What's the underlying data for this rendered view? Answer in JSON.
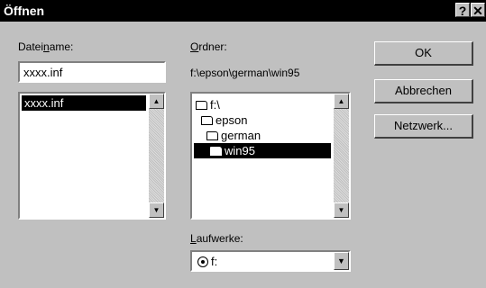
{
  "window": {
    "title": "Öffnen",
    "help_label": "?",
    "close_label": "✕"
  },
  "file": {
    "label_pre": "Datei",
    "label_key": "n",
    "label_post": "ame:",
    "value": "xxxx.inf",
    "list": [
      "xxxx.inf"
    ]
  },
  "folder": {
    "label_key": "O",
    "label_post": "rdner:",
    "path": "f:\\epson\\german\\win95",
    "tree": [
      "f:\\",
      "epson",
      "german",
      "win95"
    ]
  },
  "drives": {
    "label_key": "L",
    "label_post": "aufwerke:",
    "selected": "f:"
  },
  "buttons": {
    "ok": "OK",
    "cancel": "Abbrechen",
    "network": "Netzwerk..."
  }
}
